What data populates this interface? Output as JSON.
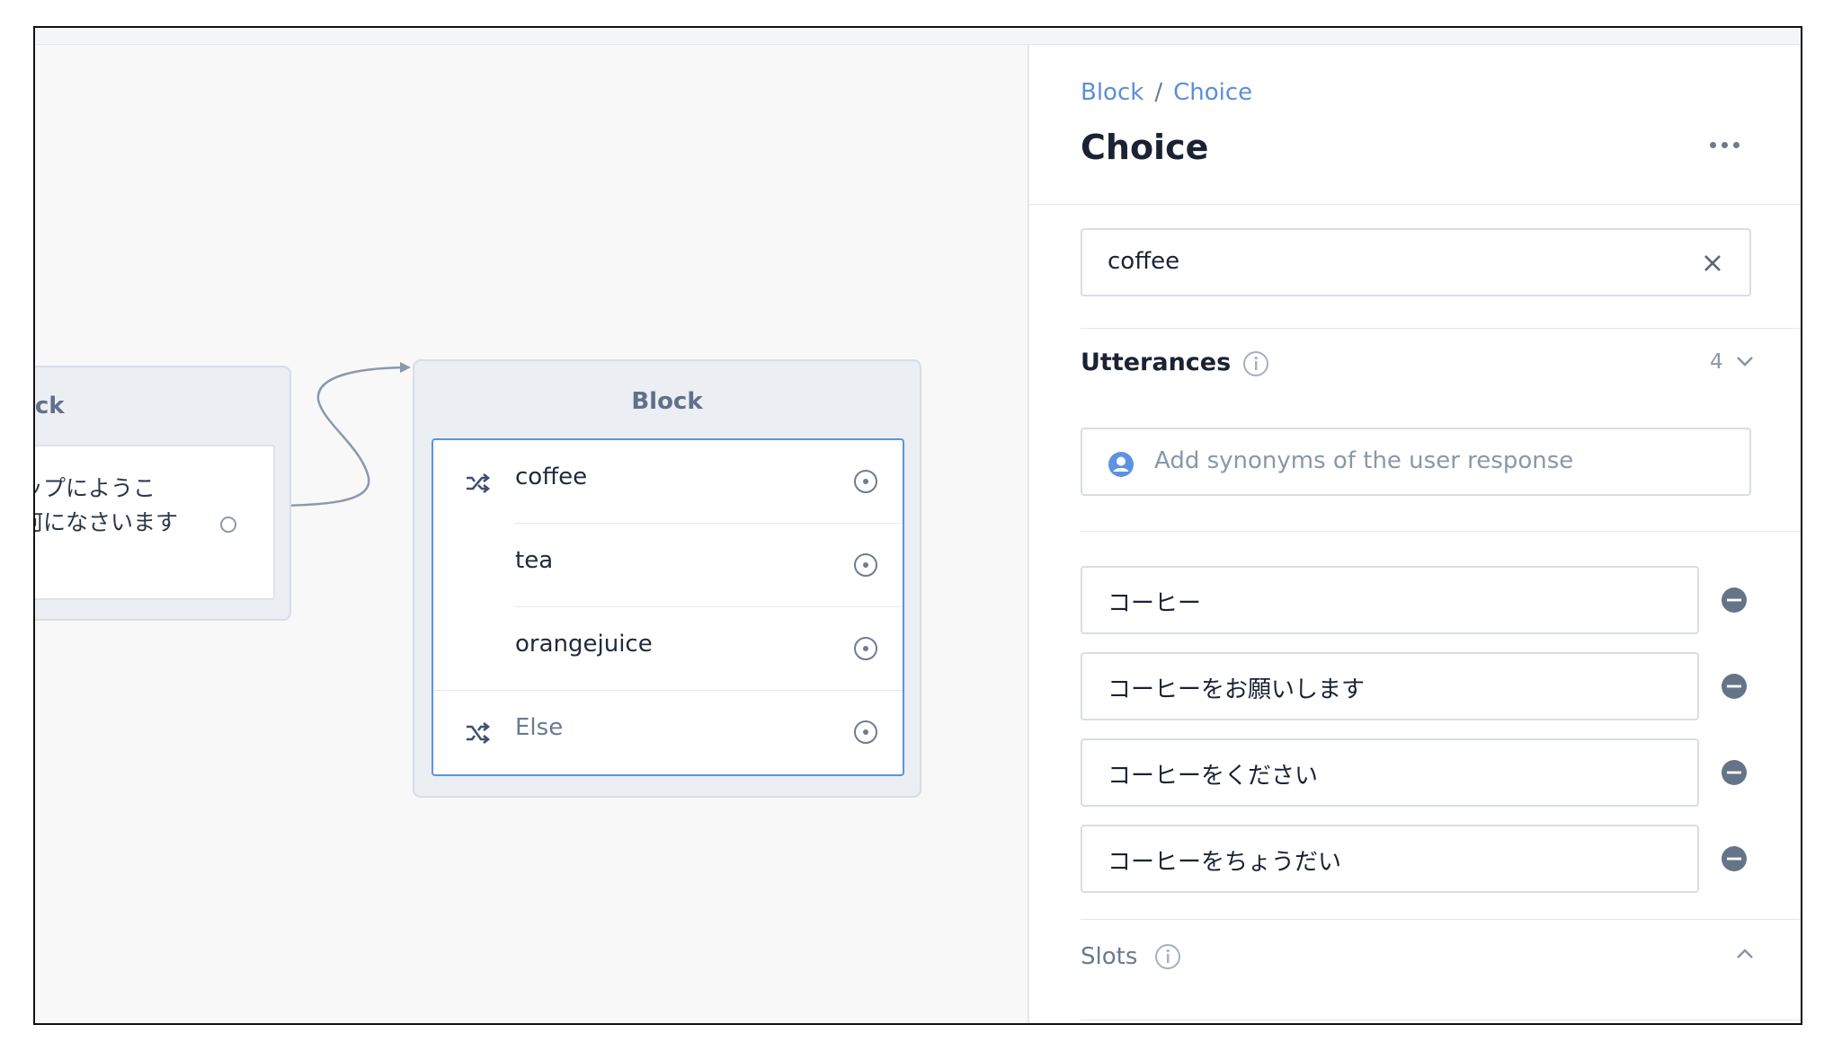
{
  "canvas": {
    "left_block": {
      "title": "ock",
      "message": "ップにようこ\n何になさいます"
    },
    "choice_block": {
      "title": "Block",
      "options": [
        {
          "label": "coffee",
          "icon": "split-arrows-icon"
        },
        {
          "label": "tea",
          "icon": ""
        },
        {
          "label": "orangejuice",
          "icon": ""
        },
        {
          "label": "Else",
          "icon": "shuffle-icon"
        }
      ]
    }
  },
  "panel": {
    "breadcrumb": [
      "Block",
      "Choice"
    ],
    "breadcrumb_separator": "/",
    "title": "Choice",
    "choice_value": "coffee",
    "utterances": {
      "label": "Utterances",
      "count": "4",
      "placeholder": "Add synonyms of the user response",
      "items": [
        "コーヒー",
        "コーヒーをお願いします",
        "コーヒーをください",
        "コーヒーをちょうだい"
      ]
    },
    "slots": {
      "label": "Slots"
    }
  },
  "colors": {
    "accent": "#5b93e0",
    "link": "#5b8fd8",
    "canvas_bg": "#f8f8f8",
    "text_dark": "#1a2233",
    "muted": "#8a97aa"
  }
}
